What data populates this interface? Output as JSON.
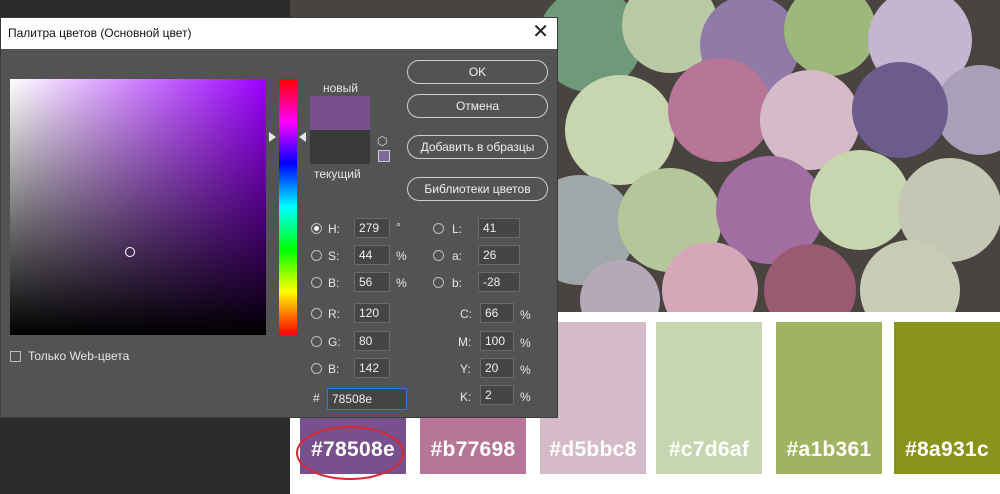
{
  "dialog": {
    "title": "Палитра цветов (Основной цвет)",
    "close_glyph": "✕",
    "new_label": "новый",
    "current_label": "текущий",
    "new_color": "#78508e",
    "current_color": "#3a3a3a",
    "buttons": {
      "ok": "OK",
      "cancel": "Отмена",
      "add_to_swatches": "Добавить в образцы",
      "color_libraries": "Библиотеки цветов"
    },
    "hsb": {
      "h_label": "H:",
      "h_value": "279",
      "h_unit": "°",
      "s_label": "S:",
      "s_value": "44",
      "s_unit": "%",
      "b_label": "B:",
      "b_value": "56",
      "b_unit": "%"
    },
    "rgb": {
      "r_label": "R:",
      "r_value": "120",
      "g_label": "G:",
      "g_value": "80",
      "b_label": "B:",
      "b_value": "142"
    },
    "lab": {
      "l_label": "L:",
      "l_value": "41",
      "a_label": "a:",
      "a_value": "26",
      "b_label": "b:",
      "b_value": "-28"
    },
    "cmyk": {
      "c_label": "C:",
      "c_value": "66",
      "c_unit": "%",
      "m_label": "M:",
      "m_value": "100",
      "m_unit": "%",
      "y_label": "Y:",
      "y_value": "20",
      "y_unit": "%",
      "k_label": "K:",
      "k_value": "2",
      "k_unit": "%"
    },
    "hex_label": "#",
    "hex_value": "78508e",
    "web_only_label": "Только Web-цвета",
    "selected_mode": "H"
  },
  "palette": [
    {
      "hex": "#78508e",
      "label": "#78508e"
    },
    {
      "hex": "#b77698",
      "label": "#b77698"
    },
    {
      "hex": "#d5bbc8",
      "label": "#d5bbc8"
    },
    {
      "hex": "#c7d6af",
      "label": "#c7d6af"
    },
    {
      "hex": "#a1b361",
      "label": "#a1b361"
    },
    {
      "hex": "#8a931c",
      "label": "#8a931c"
    }
  ],
  "colors": {
    "dialog_bg": "#535353",
    "accent_focus": "#2d7dd2",
    "annotation_red": "#d8272e"
  },
  "icons": [
    "close-icon",
    "cube-icon",
    "web-safe-warning-icon"
  ]
}
